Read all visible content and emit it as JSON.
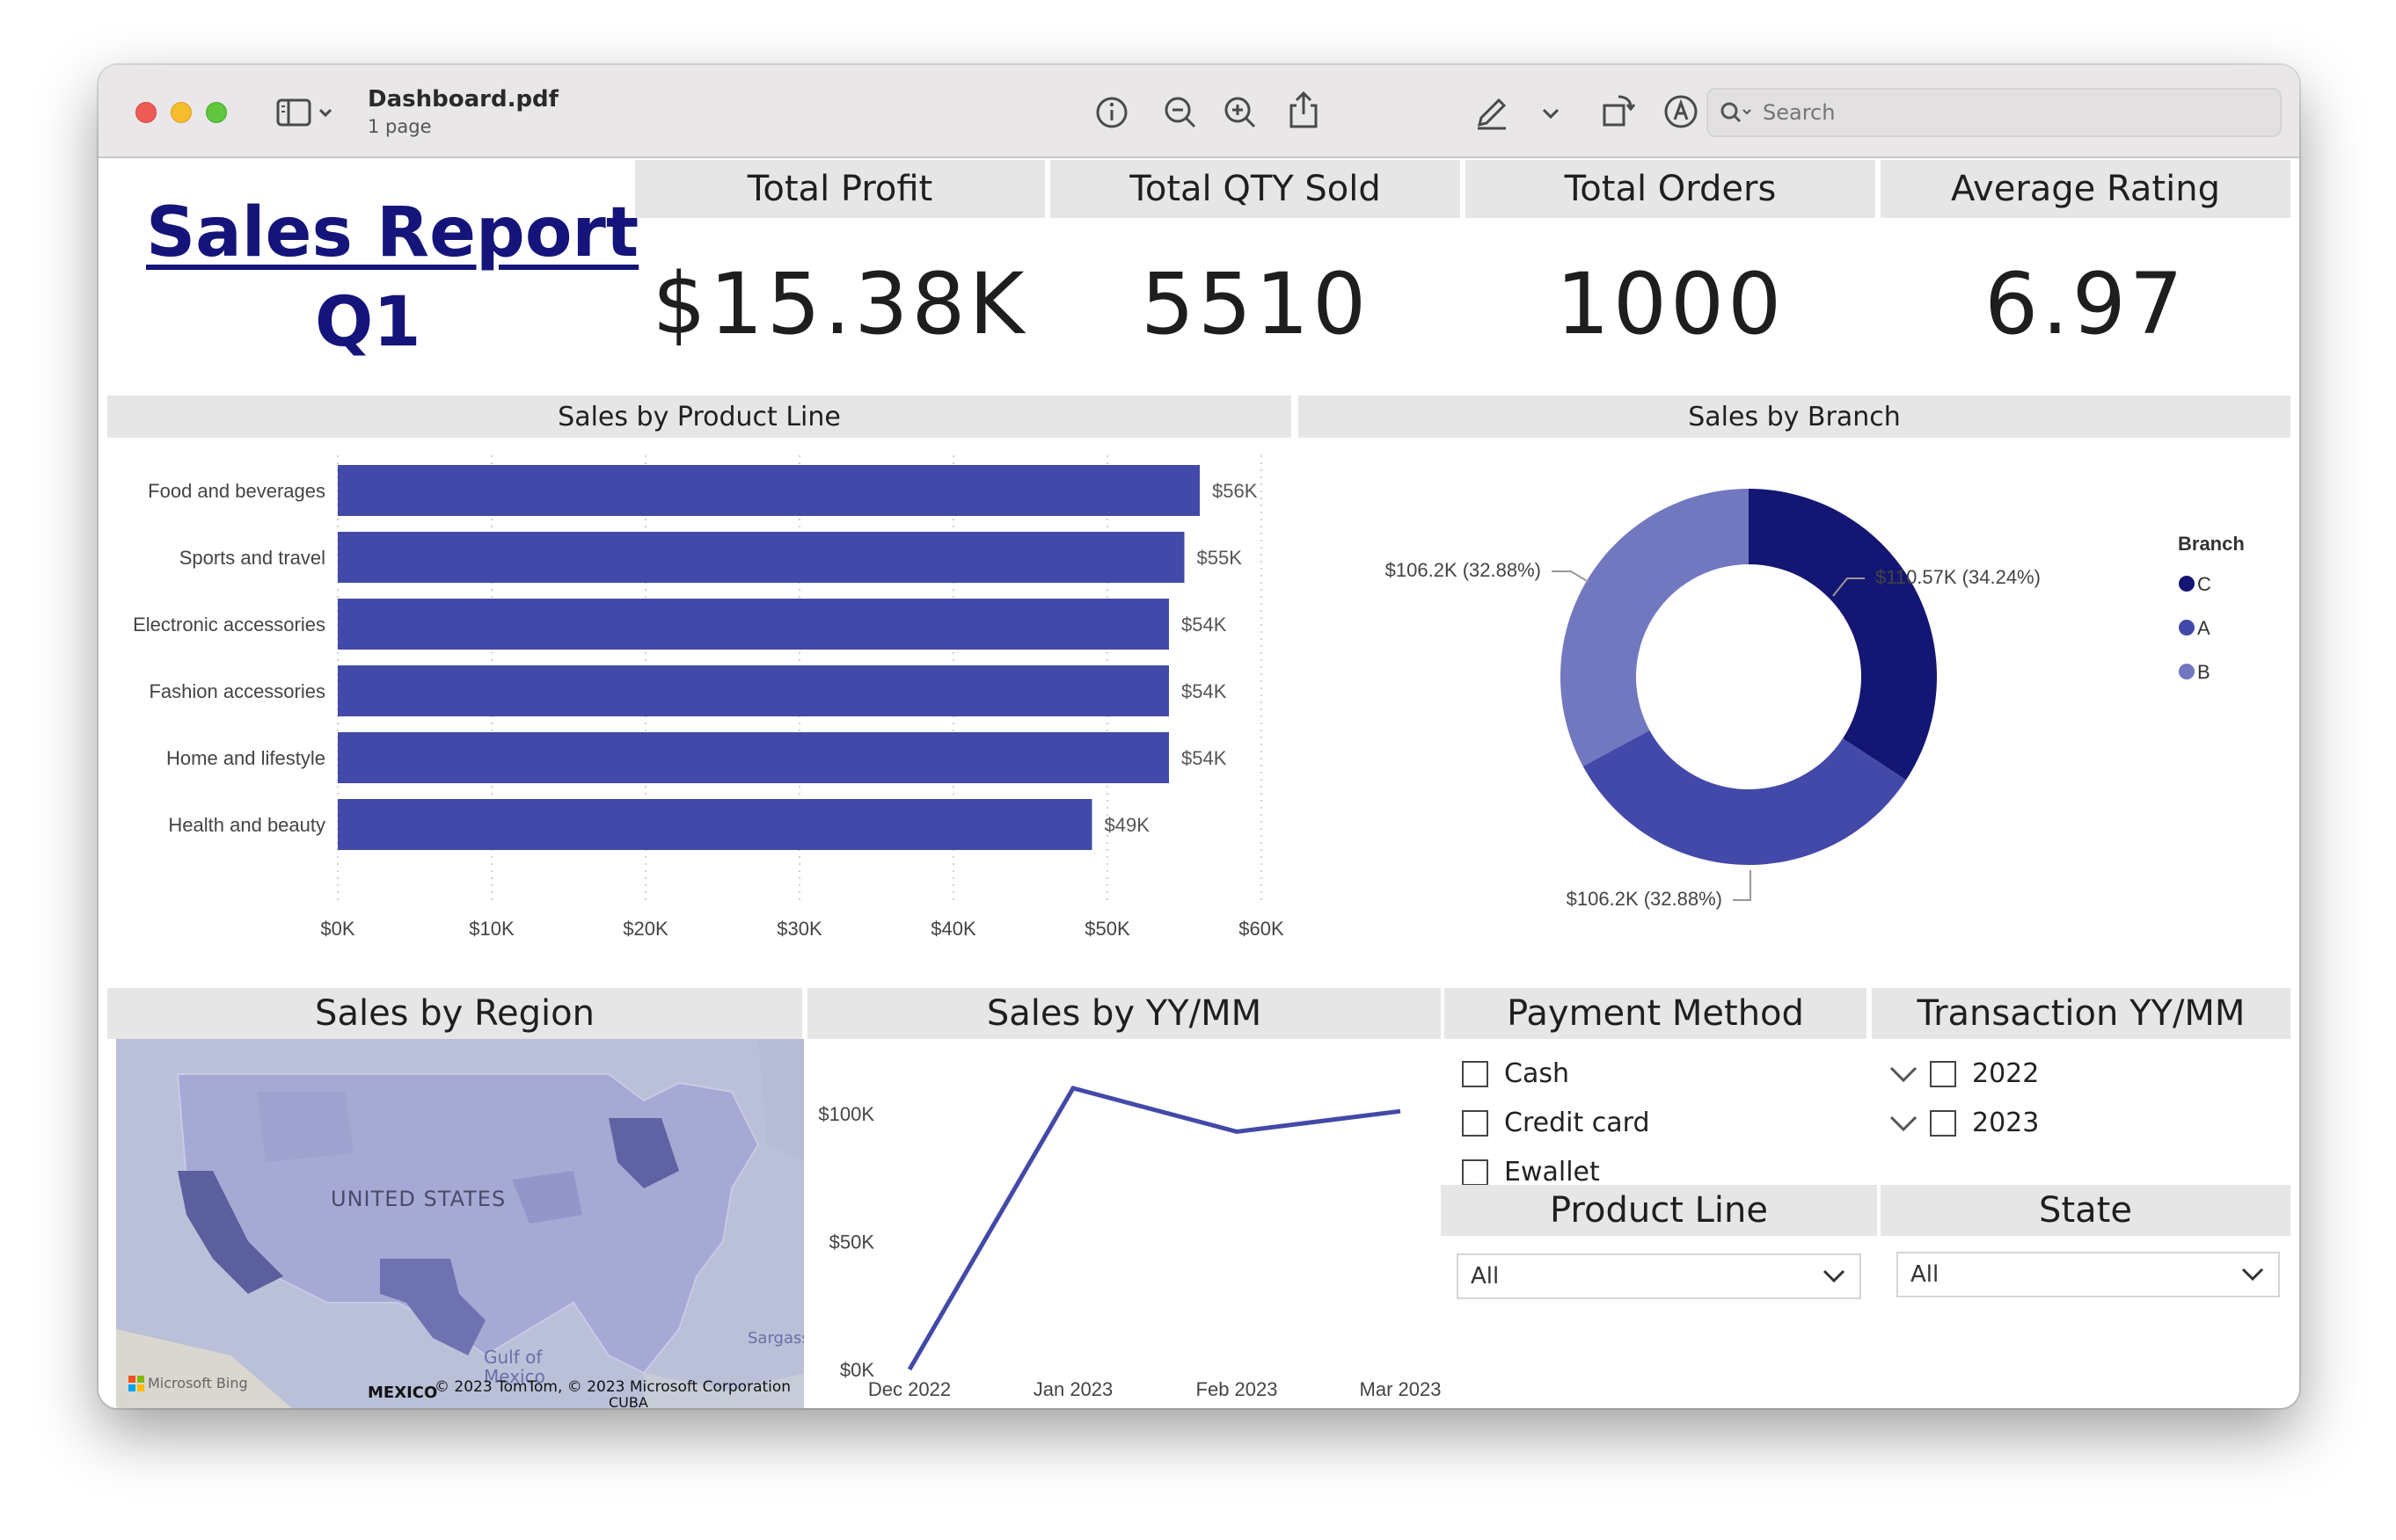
{
  "window": {
    "doc_title": "Dashboard.pdf",
    "doc_subtitle": "1 page",
    "search_placeholder": "Search"
  },
  "report": {
    "title": "Sales Report ",
    "quarter": "Q1"
  },
  "kpis": [
    {
      "label": "Total Profit",
      "value": "$15.38K"
    },
    {
      "label": "Total QTY Sold",
      "value": "5510"
    },
    {
      "label": "Total Orders",
      "value": "1000"
    },
    {
      "label": "Average Rating",
      "value": "6.97"
    }
  ],
  "sections": {
    "product_line": "Sales by Product Line",
    "branch": "Sales by Branch",
    "region": "Sales by Region",
    "yymm": "Sales by YY/MM",
    "payment": "Payment Method",
    "transaction": "Transaction YY/MM",
    "product_line_filter": "Product Line",
    "state_filter": "State"
  },
  "payment_methods": [
    "Cash",
    "Credit card",
    "Ewallet"
  ],
  "transaction_years": [
    "2022",
    "2023"
  ],
  "product_line_filter_value": "All",
  "state_filter_value": "All",
  "map": {
    "country": "UNITED STATES",
    "labels": [
      "Gulf of",
      "Mexico",
      "MEXICO",
      "CUBA",
      "Sargass"
    ],
    "attribution": "© 2023 TomTom, © 2023 Microsoft Corporation",
    "brand": "Microsoft Bing"
  },
  "chart_data": [
    {
      "type": "bar",
      "orientation": "horizontal",
      "title": "Sales by Product Line",
      "categories": [
        "Food and beverages",
        "Sports and travel",
        "Electronic accessories",
        "Fashion accessories",
        "Home and lifestyle",
        "Health and beauty"
      ],
      "values": [
        56,
        55,
        54,
        54,
        54,
        49
      ],
      "data_labels": [
        "$56K",
        "$55K",
        "$54K",
        "$54K",
        "$54K",
        "$49K"
      ],
      "x_ticks": [
        "$0K",
        "$10K",
        "$20K",
        "$30K",
        "$40K",
        "$50K",
        "$60K"
      ],
      "xlim": [
        0,
        60
      ],
      "bar_color": "#4349a8",
      "grid": true
    },
    {
      "type": "pie",
      "style": "donut",
      "title": "Sales by Branch",
      "legend_title": "Branch",
      "legend_position": "right",
      "slices": [
        {
          "name": "C",
          "value": 110.57,
          "percent": 34.24,
          "label": "$110.57K (34.24%)",
          "color": "#141673"
        },
        {
          "name": "A",
          "value": 106.2,
          "percent": 32.88,
          "label": "$106.2K (32.88%)",
          "color": "#4349a8"
        },
        {
          "name": "B",
          "value": 106.2,
          "percent": 32.88,
          "label": "$106.2K (32.88%)",
          "color": "#7178c0"
        }
      ]
    },
    {
      "type": "line",
      "title": "Sales by YY/MM",
      "categories": [
        "Dec 2022",
        "Jan 2023",
        "Feb 2023",
        "Mar 2023"
      ],
      "values": [
        0,
        110,
        93,
        101
      ],
      "y_ticks": [
        "$0K",
        "$50K",
        "$100K"
      ],
      "ylim": [
        0,
        110
      ],
      "line_color": "#4349a8"
    }
  ]
}
